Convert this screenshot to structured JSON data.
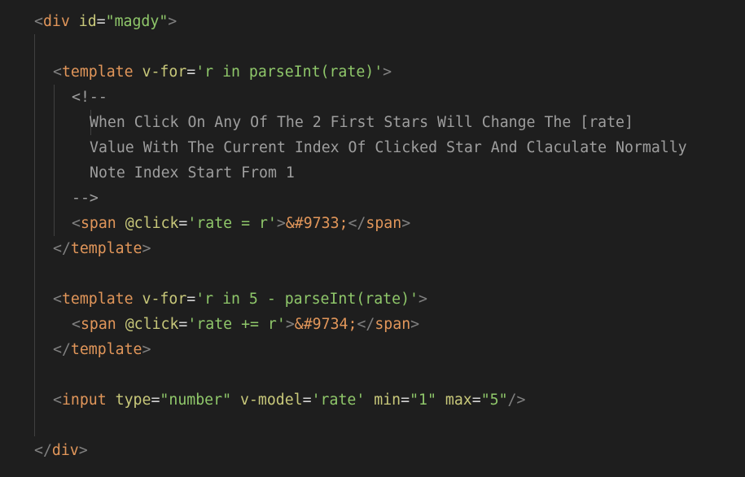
{
  "editor": {
    "theme_colors": {
      "background": "#1e1e1e",
      "tag": "#e1965a",
      "attribute": "#c8c87a",
      "string": "#8fc76a",
      "punctuation": "#808080",
      "comment": "#9e9e9e"
    },
    "lines": [
      {
        "indent": 0,
        "tokens": [
          [
            "p",
            "<"
          ],
          [
            "t",
            "div"
          ],
          [
            "s",
            " "
          ],
          [
            "a",
            "id"
          ],
          [
            "e",
            "="
          ],
          [
            "v",
            "\"magdy\""
          ],
          [
            "p",
            ">"
          ]
        ]
      },
      {
        "indent": 0,
        "tokens": []
      },
      {
        "indent": 1,
        "tokens": [
          [
            "p",
            "<"
          ],
          [
            "t",
            "template"
          ],
          [
            "s",
            " "
          ],
          [
            "a",
            "v-for"
          ],
          [
            "e",
            "="
          ],
          [
            "v",
            "'r in parseInt(rate)'"
          ],
          [
            "p",
            ">"
          ]
        ]
      },
      {
        "indent": 2,
        "tokens": [
          [
            "c",
            "<!--"
          ]
        ]
      },
      {
        "indent": 3,
        "tokens": [
          [
            "c",
            "When Click On Any Of The 2 First Stars Will Change The [rate]"
          ]
        ]
      },
      {
        "indent": 3,
        "tokens": [
          [
            "c",
            "Value With The Current Index Of Clicked Star And Claculate Normally"
          ]
        ]
      },
      {
        "indent": 3,
        "tokens": [
          [
            "c",
            "Note Index Start From 1"
          ]
        ]
      },
      {
        "indent": 2,
        "tokens": [
          [
            "c",
            "-->"
          ]
        ]
      },
      {
        "indent": 2,
        "tokens": [
          [
            "p",
            "<"
          ],
          [
            "t",
            "span"
          ],
          [
            "s",
            " "
          ],
          [
            "a",
            "@click"
          ],
          [
            "e",
            "="
          ],
          [
            "v",
            "'rate = r'"
          ],
          [
            "p",
            ">"
          ],
          [
            "x",
            "&#9733;"
          ],
          [
            "p",
            "</"
          ],
          [
            "t",
            "span"
          ],
          [
            "p",
            ">"
          ]
        ]
      },
      {
        "indent": 1,
        "tokens": [
          [
            "p",
            "</"
          ],
          [
            "t",
            "template"
          ],
          [
            "p",
            ">"
          ]
        ]
      },
      {
        "indent": 0,
        "tokens": []
      },
      {
        "indent": 1,
        "tokens": [
          [
            "p",
            "<"
          ],
          [
            "t",
            "template"
          ],
          [
            "s",
            " "
          ],
          [
            "a",
            "v-for"
          ],
          [
            "e",
            "="
          ],
          [
            "v",
            "'r in 5 - parseInt(rate)'"
          ],
          [
            "p",
            ">"
          ]
        ]
      },
      {
        "indent": 2,
        "tokens": [
          [
            "p",
            "<"
          ],
          [
            "t",
            "span"
          ],
          [
            "s",
            " "
          ],
          [
            "a",
            "@click"
          ],
          [
            "e",
            "="
          ],
          [
            "v",
            "'rate += r'"
          ],
          [
            "p",
            ">"
          ],
          [
            "x",
            "&#9734;"
          ],
          [
            "p",
            "</"
          ],
          [
            "t",
            "span"
          ],
          [
            "p",
            ">"
          ]
        ]
      },
      {
        "indent": 1,
        "tokens": [
          [
            "p",
            "</"
          ],
          [
            "t",
            "template"
          ],
          [
            "p",
            ">"
          ]
        ]
      },
      {
        "indent": 0,
        "tokens": []
      },
      {
        "indent": 1,
        "tokens": [
          [
            "p",
            "<"
          ],
          [
            "t",
            "input"
          ],
          [
            "s",
            " "
          ],
          [
            "a",
            "type"
          ],
          [
            "e",
            "="
          ],
          [
            "v",
            "\"number\""
          ],
          [
            "s",
            " "
          ],
          [
            "a",
            "v-model"
          ],
          [
            "e",
            "="
          ],
          [
            "v",
            "'rate'"
          ],
          [
            "s",
            " "
          ],
          [
            "a",
            "min"
          ],
          [
            "e",
            "="
          ],
          [
            "v",
            "\"1\""
          ],
          [
            "s",
            " "
          ],
          [
            "a",
            "max"
          ],
          [
            "e",
            "="
          ],
          [
            "v",
            "\"5\""
          ],
          [
            "p",
            "/>"
          ]
        ]
      },
      {
        "indent": 0,
        "tokens": []
      },
      {
        "indent": 0,
        "tokens": [
          [
            "p",
            "</"
          ],
          [
            "t",
            "div"
          ],
          [
            "p",
            ">"
          ]
        ]
      }
    ]
  }
}
